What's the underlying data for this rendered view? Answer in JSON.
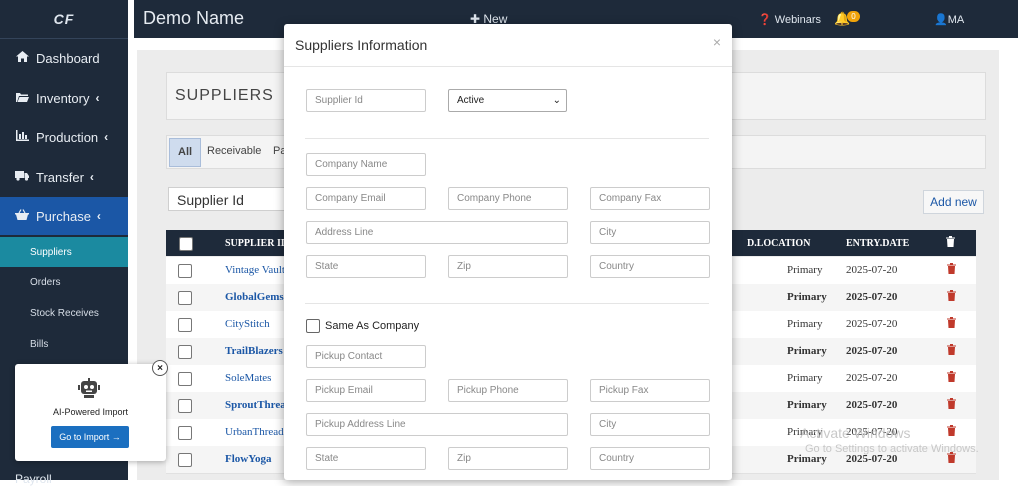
{
  "sidebar": {
    "logo": "CF",
    "items": [
      {
        "label": "Dashboard",
        "icon": "home-icon"
      },
      {
        "label": "Inventory",
        "icon": "folder-icon"
      },
      {
        "label": "Production",
        "icon": "bar-chart-icon"
      },
      {
        "label": "Transfer",
        "icon": "truck-icon"
      },
      {
        "label": "Purchase",
        "icon": "basket-icon"
      }
    ],
    "subitems": [
      "Suppliers",
      "Orders",
      "Stock Receives",
      "Bills"
    ],
    "partial_item": "Payroll"
  },
  "topbar": {
    "title": "Demo Name",
    "new_label": "New",
    "webinars_label": "Webinars",
    "notification_count": "0",
    "user_label": "MA"
  },
  "page": {
    "heading": "SUPPLIERS",
    "filter_tabs": [
      "All",
      "Receivable",
      "Pa"
    ],
    "search_value": "Supplier Id",
    "add_new_label": "Add new",
    "table": {
      "headers": [
        "SUPPLIER ID",
        "D.LOCATION",
        "ENTRY.DATE"
      ],
      "rows": [
        {
          "name": "Vintage Vault",
          "location": "Primary",
          "date": "2025-07-20"
        },
        {
          "name": "GlobalGems",
          "location": "Primary",
          "date": "2025-07-20"
        },
        {
          "name": "CityStitch",
          "location": "Primary",
          "date": "2025-07-20"
        },
        {
          "name": "TrailBlazers",
          "location": "Primary",
          "date": "2025-07-20"
        },
        {
          "name": "SoleMates",
          "location": "Primary",
          "date": "2025-07-20"
        },
        {
          "name": "SproutThread",
          "location": "Primary",
          "date": "2025-07-20"
        },
        {
          "name": "UrbanThreadz",
          "location": "Primary",
          "date": "2025-07-20"
        },
        {
          "name": "FlowYoga",
          "location": "Primary",
          "date": "2025-07-20"
        }
      ]
    }
  },
  "modal": {
    "title": "Suppliers Information",
    "close_glyph": "×",
    "status_selected": "Active",
    "placeholders": {
      "supplier_id": "Supplier Id",
      "company_name": "Company Name",
      "company_email": "Company Email",
      "company_phone": "Company Phone",
      "company_fax": "Company Fax",
      "address_line": "Address Line",
      "city": "City",
      "state": "State",
      "zip": "Zip",
      "country": "Country",
      "pickup_contact": "Pickup Contact",
      "pickup_email": "Pickup Email",
      "pickup_phone": "Pickup Phone",
      "pickup_fax": "Pickup Fax",
      "pickup_address_line": "Pickup Address Line",
      "pickup_city": "City",
      "pickup_state": "State",
      "pickup_zip": "Zip",
      "pickup_country": "Country"
    },
    "same_as_company_label": "Same As Company"
  },
  "ai_card": {
    "label": "AI-Powered Import",
    "button": "Go to Import →",
    "close_glyph": "×"
  },
  "watermark": {
    "line1": "Activate Windows",
    "line2": "Go to Settings to activate Windows."
  },
  "colors": {
    "sidebar_bg": "#1e2a3a",
    "active_item": "#1b57a6",
    "active_subitem": "#1b8aa0",
    "link": "#1b57a6",
    "trash": "#c0392b",
    "import_button": "#1b6fc0"
  }
}
